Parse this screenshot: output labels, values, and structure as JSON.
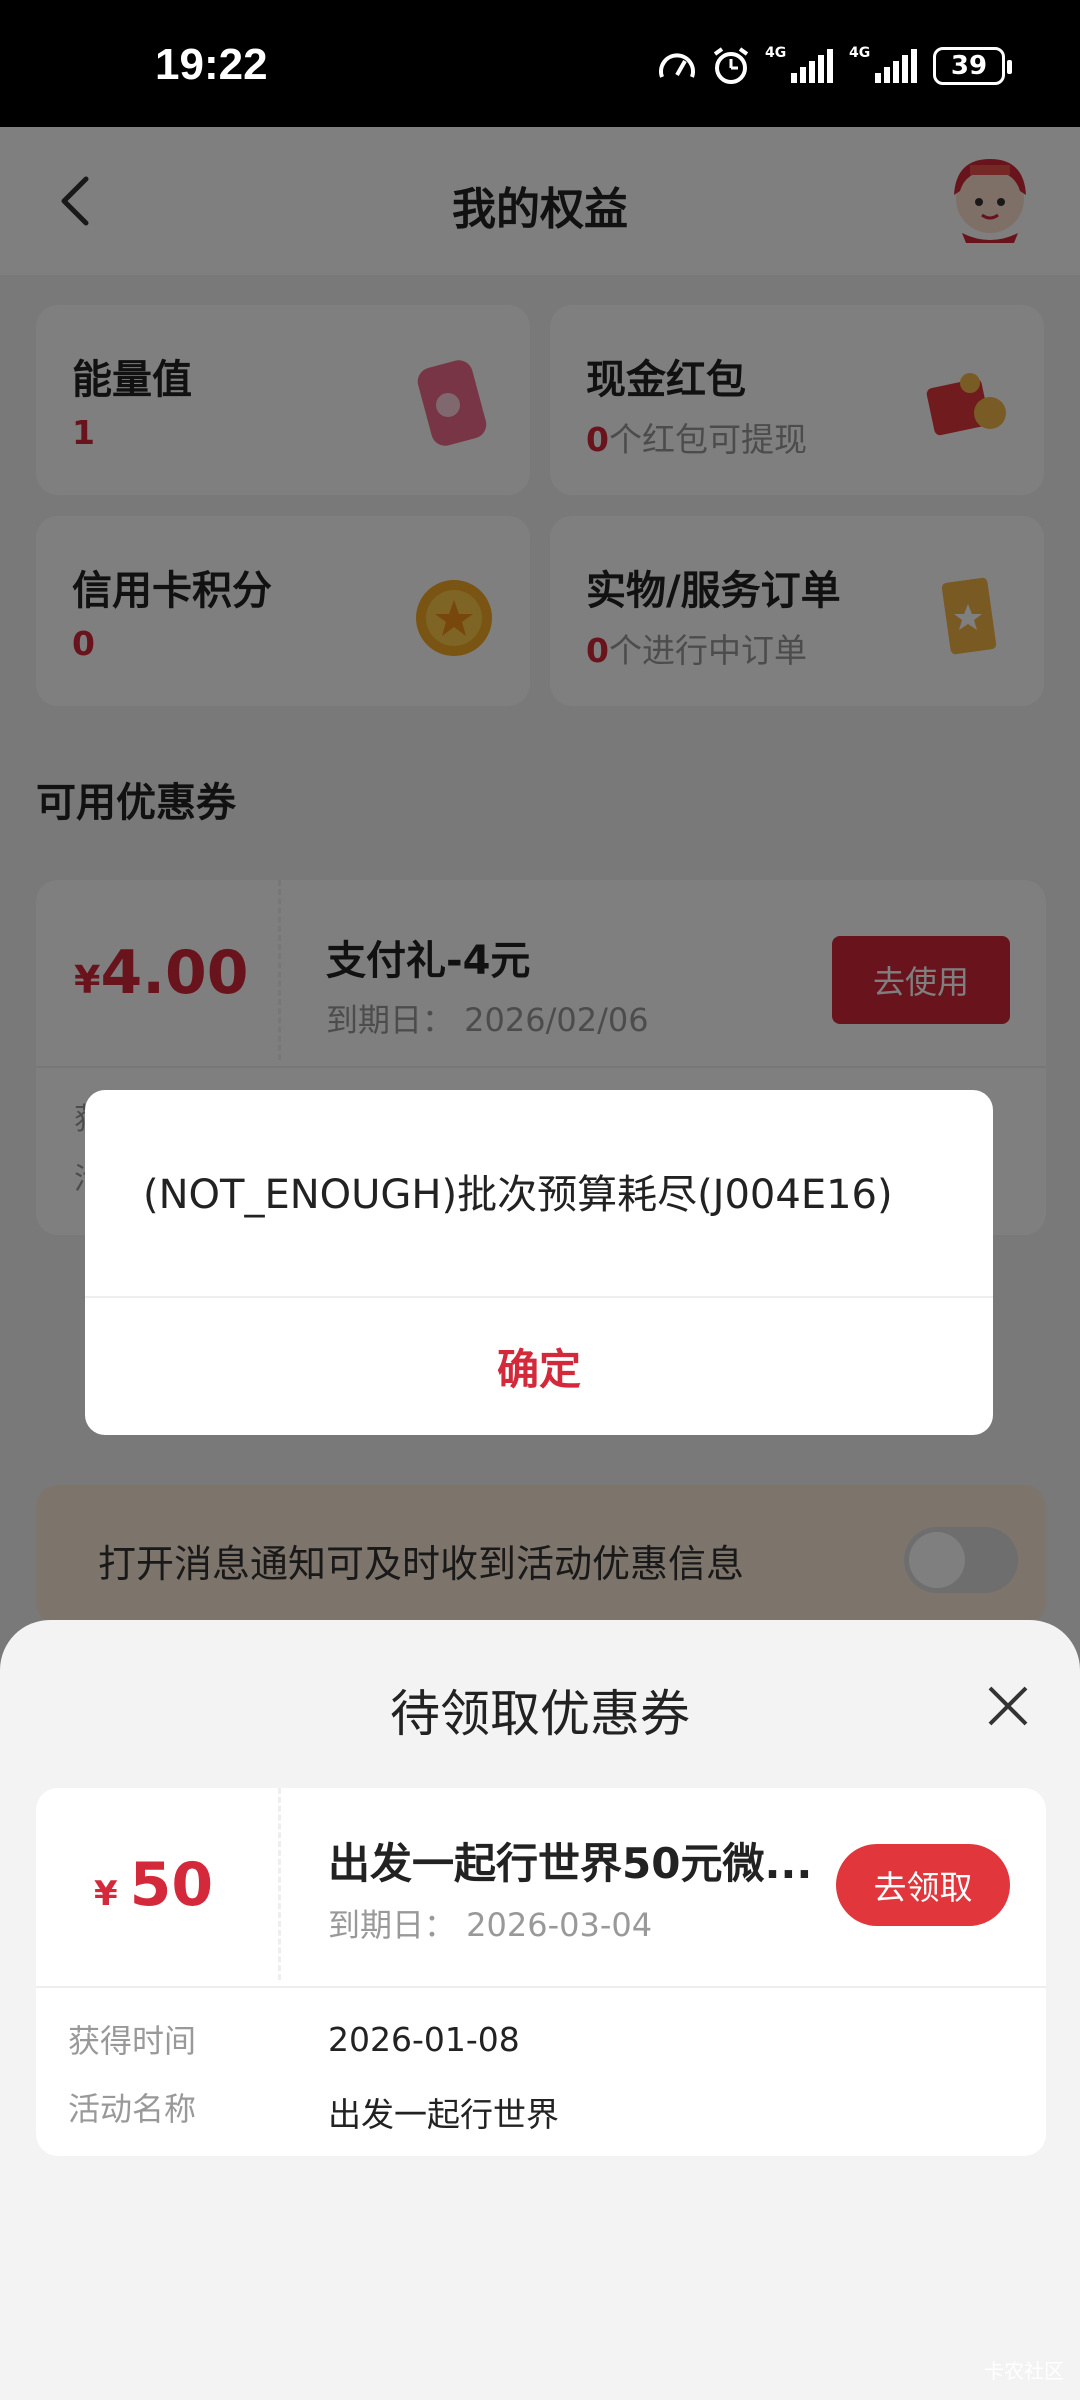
{
  "status_bar": {
    "time": "19:22",
    "network_1": "4G",
    "network_2": "4G",
    "battery": "39",
    "icons": [
      "speedometer-icon",
      "alarm-icon",
      "signal-icon",
      "signal-icon",
      "battery-icon"
    ]
  },
  "header": {
    "title": "我的权益",
    "icons": [
      "chevron-left-icon",
      "mascot-avatar"
    ]
  },
  "cards": [
    {
      "title": "能量值",
      "value_red": "1",
      "value_rest": "",
      "icon": "energy-cup-icon"
    },
    {
      "title": "现金红包",
      "value_red": "0",
      "value_rest": "个红包可提现",
      "icon": "red-packet-icon"
    },
    {
      "title": "信用卡积分",
      "value_red": "0",
      "value_rest": "",
      "icon": "coin-icon"
    },
    {
      "title": "实物/服务订单",
      "value_red": "0",
      "value_rest": "个进行中订单",
      "icon": "order-book-icon"
    }
  ],
  "available": {
    "section_title": "可用优惠券",
    "coupon": {
      "currency": "¥",
      "amount": "4.00",
      "name": "支付礼-4元",
      "expiry": "到期日：  2026/02/06",
      "button": "去使用",
      "label_1": "获",
      "label_2": "活"
    }
  },
  "notice": {
    "text": "打开消息通知可及时收到活动优惠信息",
    "toggle_on": false
  },
  "sheet": {
    "title": "待领取优惠券",
    "coupon": {
      "currency": "¥",
      "amount": "50",
      "name": "出发一起行世界50元微...",
      "expiry": "到期日：  2026-03-04",
      "button": "去领取",
      "obtained_label": "获得时间",
      "obtained_value": "2026-01-08",
      "activity_label": "活动名称",
      "activity_value": "出发一起行世界"
    }
  },
  "dialog": {
    "message": "(NOT_ENOUGH)批次预算耗尽(J004E16)",
    "confirm": "确定"
  },
  "watermark": "卡农社区",
  "colors": {
    "accent_red": "#d3293a",
    "overlay": "rgba(0,0,0,0.5)",
    "notice_bg": "#fbe9d7"
  }
}
